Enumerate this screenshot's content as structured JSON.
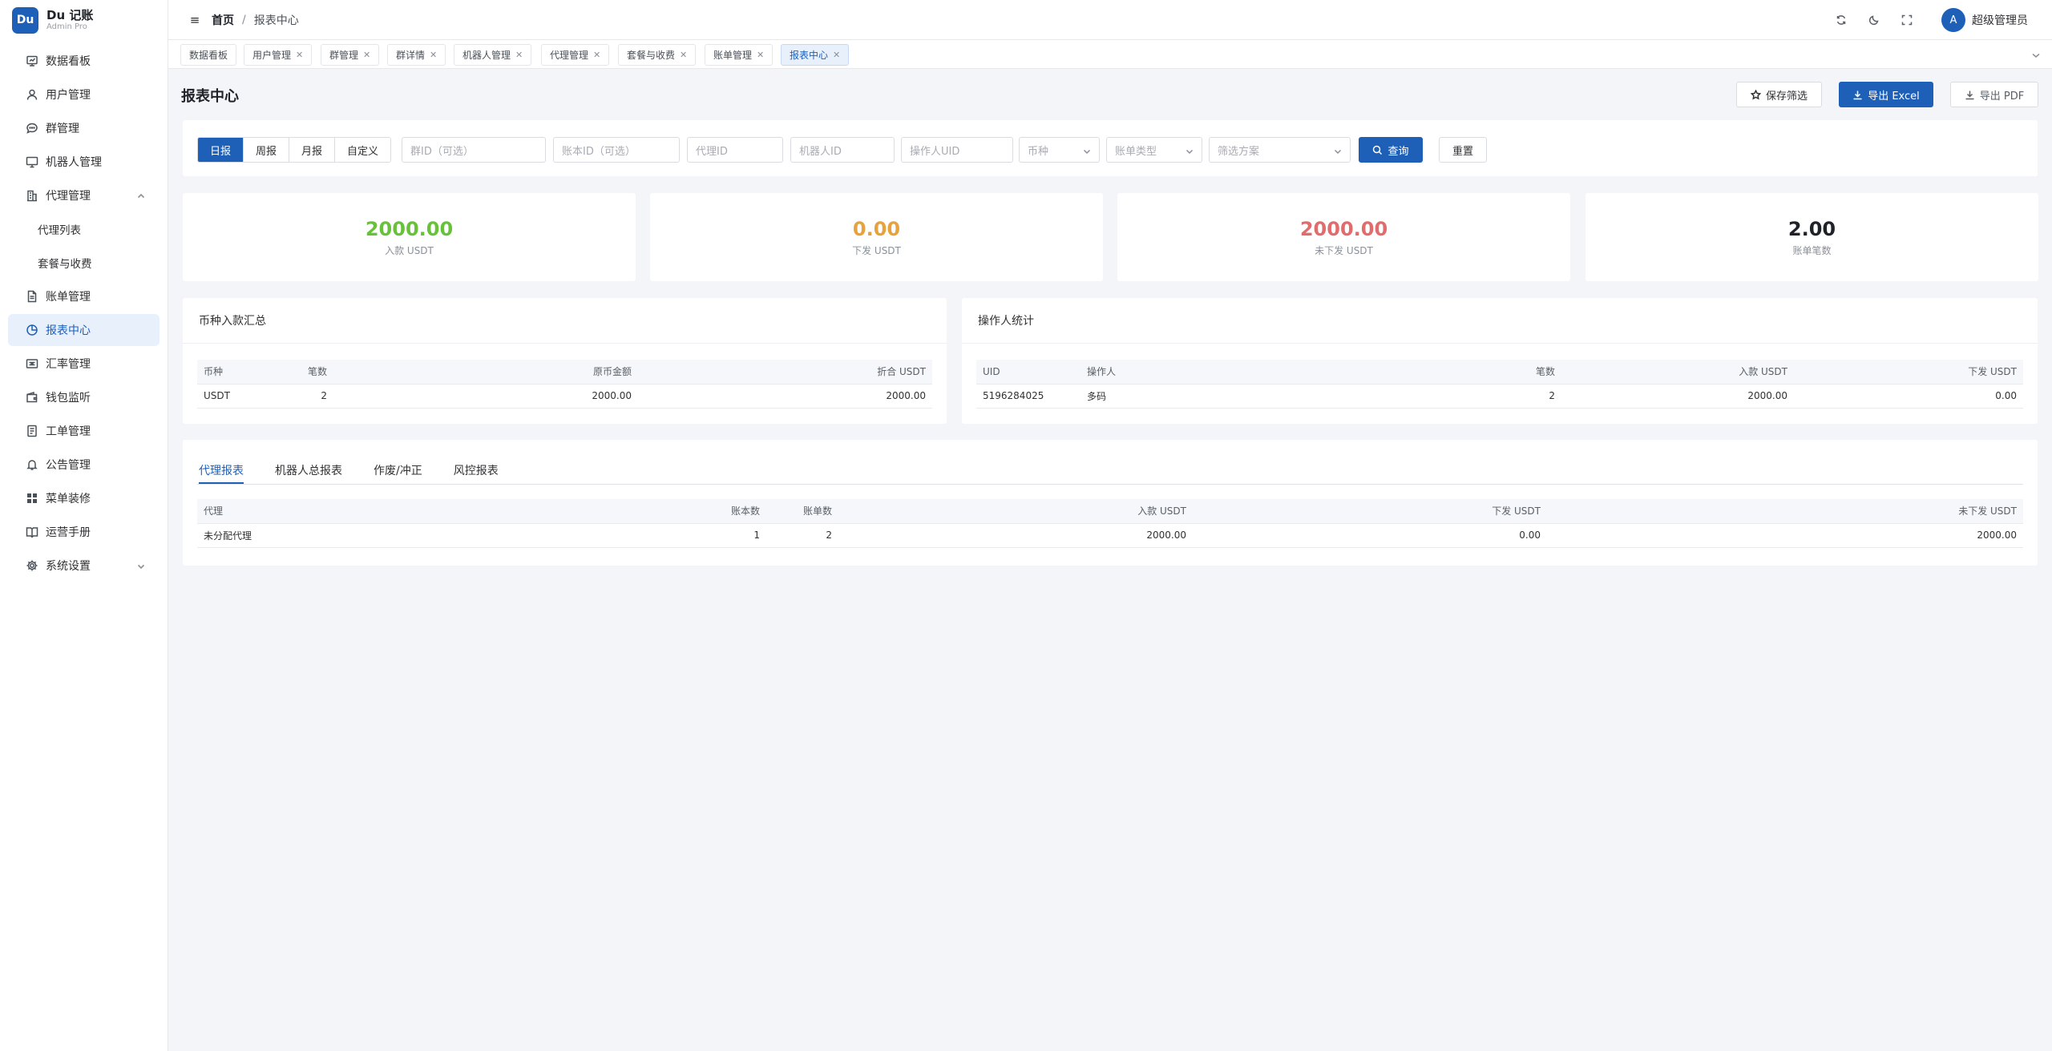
{
  "brand": {
    "logo": "Du",
    "title": "Du 记账",
    "subtitle": "Admin Pro"
  },
  "sidebar": {
    "items": [
      {
        "label": "数据看板",
        "icon": "dashboard-icon"
      },
      {
        "label": "用户管理",
        "icon": "user-icon"
      },
      {
        "label": "群管理",
        "icon": "chat-icon"
      },
      {
        "label": "机器人管理",
        "icon": "monitor-icon"
      },
      {
        "label": "代理管理",
        "icon": "building-icon",
        "expanded": true
      },
      {
        "label": "代理列表",
        "sub": true
      },
      {
        "label": "套餐与收费",
        "sub": true
      },
      {
        "label": "账单管理",
        "icon": "document-icon"
      },
      {
        "label": "报表中心",
        "icon": "pie-chart-icon",
        "active": true
      },
      {
        "label": "汇率管理",
        "icon": "exchange-icon"
      },
      {
        "label": "钱包监听",
        "icon": "wallet-icon"
      },
      {
        "label": "工单管理",
        "icon": "ticket-icon"
      },
      {
        "label": "公告管理",
        "icon": "bell-icon"
      },
      {
        "label": "菜单装修",
        "icon": "grid-icon"
      },
      {
        "label": "运营手册",
        "icon": "book-icon"
      },
      {
        "label": "系统设置",
        "icon": "gear-icon",
        "collapsed": true
      }
    ]
  },
  "header": {
    "breadcrumb_home": "首页",
    "breadcrumb_sep": "/",
    "breadcrumb_current": "报表中心",
    "avatar_letter": "A",
    "user_name": "超级管理员"
  },
  "tabs": [
    {
      "label": "数据看板",
      "closable": false
    },
    {
      "label": "用户管理",
      "closable": true
    },
    {
      "label": "群管理",
      "closable": true
    },
    {
      "label": "群详情",
      "closable": true
    },
    {
      "label": "机器人管理",
      "closable": true
    },
    {
      "label": "代理管理",
      "closable": true
    },
    {
      "label": "套餐与收费",
      "closable": true
    },
    {
      "label": "账单管理",
      "closable": true
    },
    {
      "label": "报表中心",
      "closable": true,
      "active": true
    }
  ],
  "page": {
    "title": "报表中心",
    "save_filter_label": "保存筛选",
    "export_excel_label": "导出 Excel",
    "export_pdf_label": "导出 PDF"
  },
  "filters": {
    "periods": [
      "日报",
      "周报",
      "月报",
      "自定义"
    ],
    "active_period": "日报",
    "group_id_placeholder": "群ID（可选）",
    "account_id_placeholder": "账本ID（可选）",
    "agent_id_placeholder": "代理ID",
    "robot_id_placeholder": "机器人ID",
    "operator_uid_placeholder": "操作人UID",
    "currency_placeholder": "币种",
    "bill_type_placeholder": "账单类型",
    "scheme_placeholder": "筛选方案",
    "query_label": "查询",
    "reset_label": "重置"
  },
  "stats": [
    {
      "value": "2000.00",
      "label": "入款 USDT",
      "color": "#67c23a"
    },
    {
      "value": "0.00",
      "label": "下发 USDT",
      "color": "#e6a23c"
    },
    {
      "value": "2000.00",
      "label": "未下发 USDT",
      "color": "#e06c6c"
    },
    {
      "value": "2.00",
      "label": "账单笔数",
      "color": "#1f2329"
    }
  ],
  "currency_summary": {
    "title": "币种入款汇总",
    "columns": [
      "币种",
      "笔数",
      "原币金额",
      "折合 USDT"
    ],
    "rows": [
      [
        "USDT",
        "2",
        "2000.00",
        "2000.00"
      ]
    ]
  },
  "operator_stats": {
    "title": "操作人统计",
    "columns": [
      "UID",
      "操作人",
      "笔数",
      "入款 USDT",
      "下发 USDT"
    ],
    "rows": [
      [
        "5196284025",
        "多码",
        "2",
        "2000.00",
        "0.00"
      ]
    ]
  },
  "reports": {
    "tabs": [
      "代理报表",
      "机器人总报表",
      "作废/冲正",
      "风控报表"
    ],
    "active_tab": "代理报表",
    "columns": [
      "代理",
      "账本数",
      "账单数",
      "入款 USDT",
      "下发 USDT",
      "未下发 USDT"
    ],
    "rows": [
      [
        "未分配代理",
        "1",
        "2",
        "2000.00",
        "0.00",
        "2000.00"
      ]
    ]
  }
}
